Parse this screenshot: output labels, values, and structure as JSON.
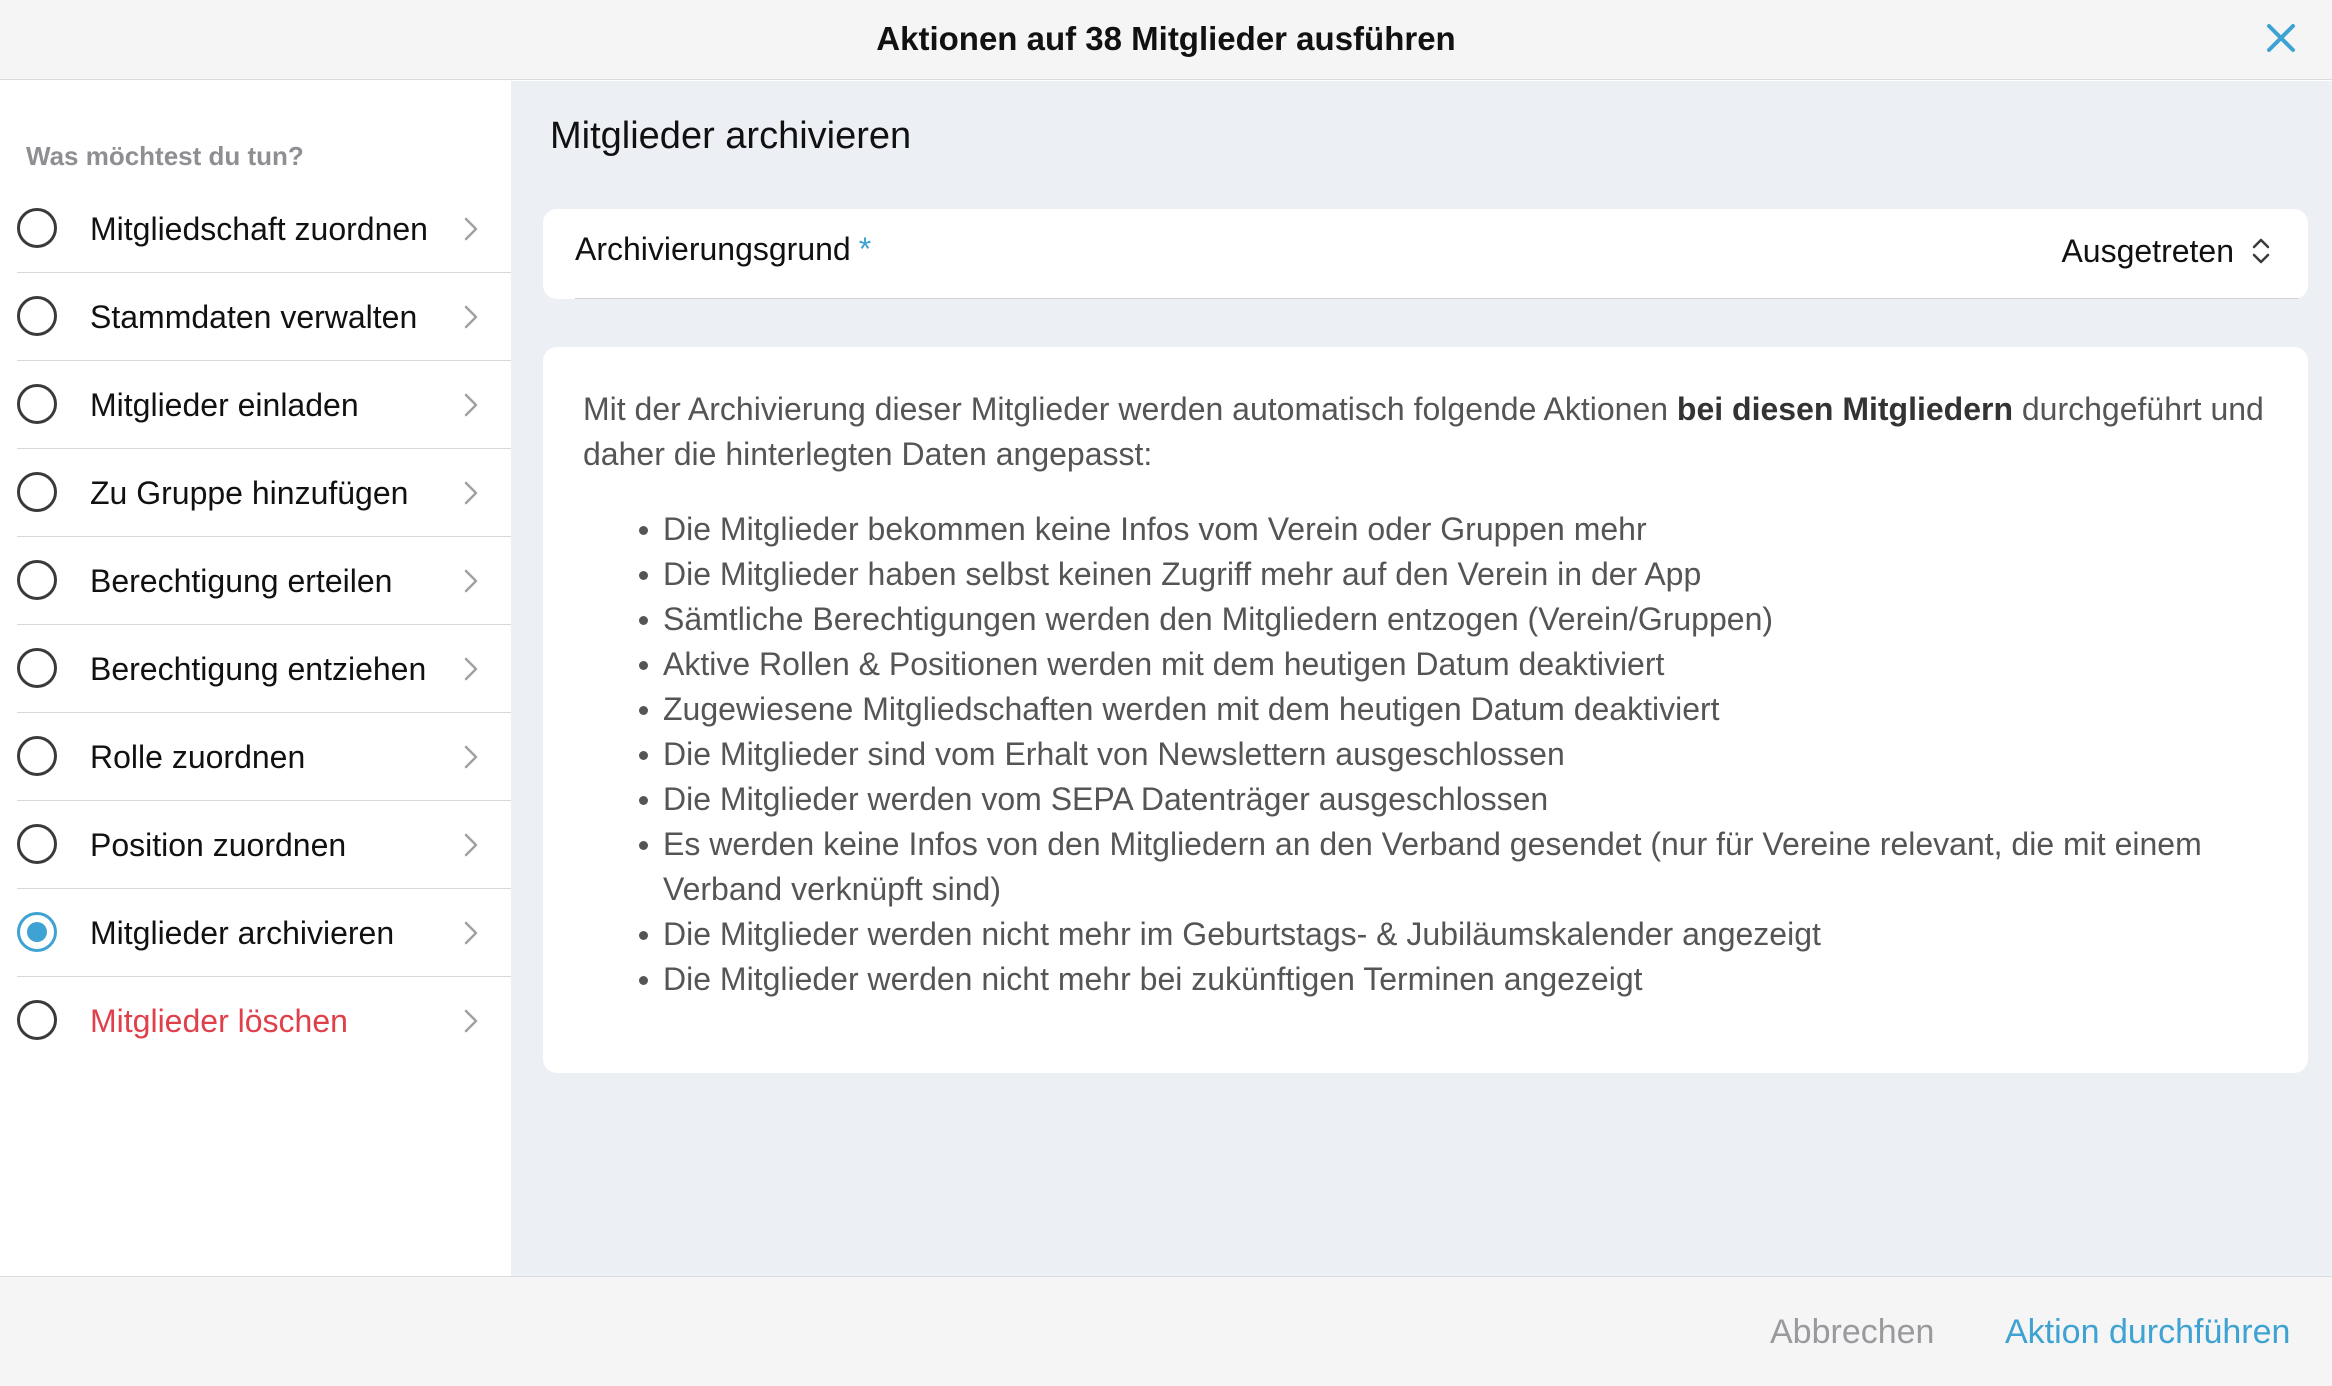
{
  "header": {
    "title": "Aktionen auf 38 Mitglieder ausführen"
  },
  "sidebar": {
    "heading": "Was möchtest du tun?",
    "items": [
      {
        "label": "Mitgliedschaft zuordnen",
        "selected": false
      },
      {
        "label": "Stammdaten verwalten",
        "selected": false
      },
      {
        "label": "Mitglieder einladen",
        "selected": false
      },
      {
        "label": "Zu Gruppe hinzufügen",
        "selected": false
      },
      {
        "label": "Berechtigung erteilen",
        "selected": false
      },
      {
        "label": "Berechtigung entziehen",
        "selected": false
      },
      {
        "label": "Rolle zuordnen",
        "selected": false
      },
      {
        "label": "Position zuordnen",
        "selected": false
      },
      {
        "label": "Mitglieder archivieren",
        "selected": true
      },
      {
        "label": "Mitglieder löschen",
        "selected": false,
        "danger": true
      }
    ]
  },
  "main": {
    "title": "Mitglieder archivieren",
    "reason_field": {
      "label": "Archivierungsgrund",
      "required_mark": "*",
      "value": "Ausgetreten"
    },
    "info": {
      "intro_before": "Mit der Archivierung dieser Mitglieder werden automatisch folgende Aktionen ",
      "intro_bold": "bei diesen Mitgliedern",
      "intro_after": " durchgeführt und daher die hinterlegten Daten angepasst:",
      "bullets": [
        "Die Mitglieder bekommen keine Infos vom Verein oder Gruppen mehr",
        "Die Mitglieder haben selbst keinen Zugriff mehr auf den Verein in der App",
        "Sämtliche Berechtigungen werden den Mitgliedern entzogen (Verein/Gruppen)",
        "Aktive Rollen & Positionen werden mit dem heutigen Datum deaktiviert",
        "Zugewiesene Mitgliedschaften werden mit dem heutigen Datum deaktiviert",
        "Die Mitglieder sind vom Erhalt von Newslettern ausgeschlossen",
        "Die Mitglieder werden vom SEPA Datenträger ausgeschlossen",
        "Es werden keine Infos von den Mitgliedern an den Verband gesendet (nur für Vereine relevant, die mit einem Verband verknüpft sind)",
        "Die Mitglieder werden nicht mehr im Geburtstags- & Jubiläumskalender angezeigt",
        "Die Mitglieder werden nicht mehr bei zukünftigen Terminen angezeigt"
      ]
    }
  },
  "footer": {
    "cancel_label": "Abbrechen",
    "confirm_label": "Aktion durchführen"
  },
  "colors": {
    "accent": "#3ea2d2",
    "danger": "#e0404a",
    "main_background": "#eceff4"
  },
  "icons": {
    "close": "close-icon",
    "chevron": "chevron-right-icon",
    "select": "chevron-up-down-icon"
  }
}
